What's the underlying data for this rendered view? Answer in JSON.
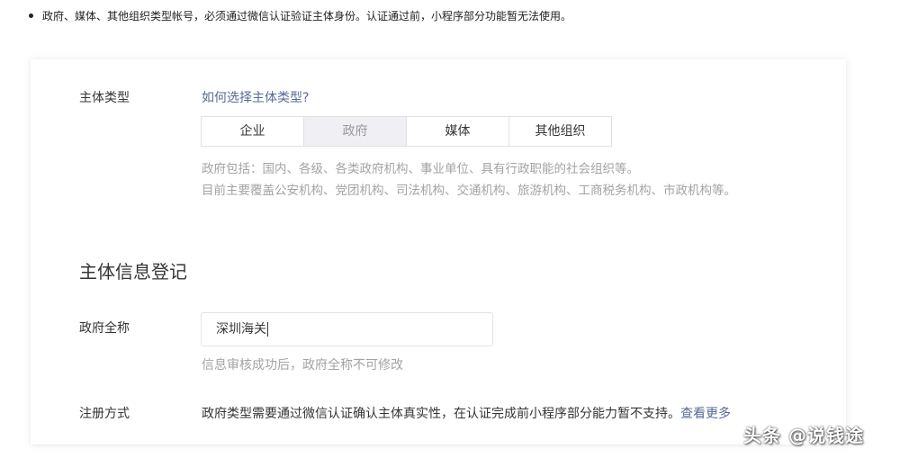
{
  "notice": {
    "text": "政府、媒体、其他组织类型帐号，必须通过微信认证验证主体身份。认证通过前，小程序部分功能暂无法使用。"
  },
  "subject_type": {
    "label": "主体类型",
    "help_link": "如何选择主体类型?",
    "options": [
      "企业",
      "政府",
      "媒体",
      "其他组织"
    ],
    "selected": "政府",
    "desc_line1": "政府包括：国内、各级、各类政府机构、事业单位、具有行政职能的社会组织等。",
    "desc_line2": "目前主要覆盖公安机构、党团机构、司法机构、交通机构、旅游机构、工商税务机构、市政机构等。"
  },
  "info_section": {
    "title": "主体信息登记",
    "gov_name": {
      "label": "政府全称",
      "value": "深圳海关",
      "hint": "信息审核成功后，政府全称不可修改"
    },
    "registration": {
      "label": "注册方式",
      "text": "政府类型需要通过微信认证确认主体真实性，在认证完成前小程序部分能力暂不支持。",
      "link": "查看更多"
    }
  },
  "watermark": "头条 @说钱途",
  "colors": {
    "link": "#576b95",
    "muted": "#a3a3a3",
    "selected_bg": "#f0f0f4"
  }
}
